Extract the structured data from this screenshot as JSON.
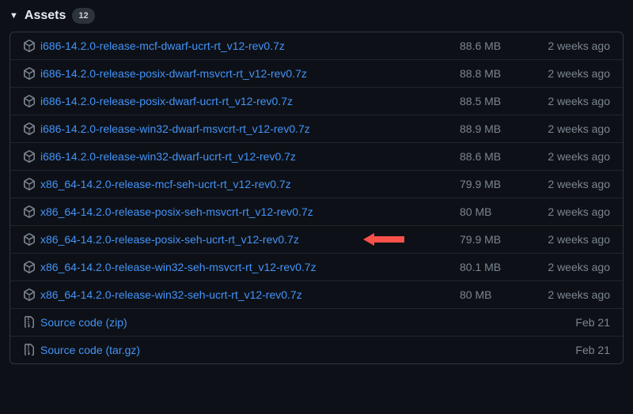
{
  "header": {
    "title": "Assets",
    "count": "12"
  },
  "annotation": {
    "arrow_target_index": 7,
    "arrow_color": "#f85149"
  },
  "assets": [
    {
      "icon": "package",
      "name": "i686-14.2.0-release-mcf-dwarf-ucrt-rt_v12-rev0.7z",
      "size": "88.6 MB",
      "date": "2 weeks ago"
    },
    {
      "icon": "package",
      "name": "i686-14.2.0-release-posix-dwarf-msvcrt-rt_v12-rev0.7z",
      "size": "88.8 MB",
      "date": "2 weeks ago"
    },
    {
      "icon": "package",
      "name": "i686-14.2.0-release-posix-dwarf-ucrt-rt_v12-rev0.7z",
      "size": "88.5 MB",
      "date": "2 weeks ago"
    },
    {
      "icon": "package",
      "name": "i686-14.2.0-release-win32-dwarf-msvcrt-rt_v12-rev0.7z",
      "size": "88.9 MB",
      "date": "2 weeks ago"
    },
    {
      "icon": "package",
      "name": "i686-14.2.0-release-win32-dwarf-ucrt-rt_v12-rev0.7z",
      "size": "88.6 MB",
      "date": "2 weeks ago"
    },
    {
      "icon": "package",
      "name": "x86_64-14.2.0-release-mcf-seh-ucrt-rt_v12-rev0.7z",
      "size": "79.9 MB",
      "date": "2 weeks ago"
    },
    {
      "icon": "package",
      "name": "x86_64-14.2.0-release-posix-seh-msvcrt-rt_v12-rev0.7z",
      "size": "80 MB",
      "date": "2 weeks ago"
    },
    {
      "icon": "package",
      "name": "x86_64-14.2.0-release-posix-seh-ucrt-rt_v12-rev0.7z",
      "size": "79.9 MB",
      "date": "2 weeks ago"
    },
    {
      "icon": "package",
      "name": "x86_64-14.2.0-release-win32-seh-msvcrt-rt_v12-rev0.7z",
      "size": "80.1 MB",
      "date": "2 weeks ago"
    },
    {
      "icon": "package",
      "name": "x86_64-14.2.0-release-win32-seh-ucrt-rt_v12-rev0.7z",
      "size": "80 MB",
      "date": "2 weeks ago"
    },
    {
      "icon": "zip",
      "name": "Source code (zip)",
      "size": "",
      "date": "Feb 21"
    },
    {
      "icon": "zip",
      "name": "Source code (tar.gz)",
      "size": "",
      "date": "Feb 21"
    }
  ]
}
